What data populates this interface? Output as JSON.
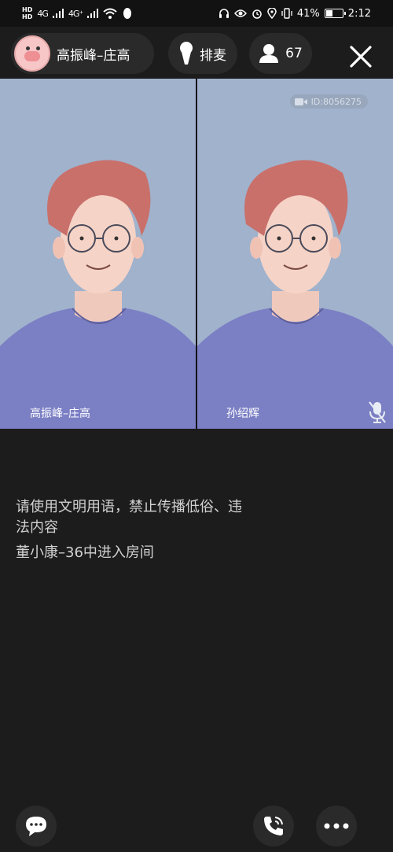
{
  "status_bar": {
    "hd_top": "HD",
    "hd_bottom": "HD",
    "network_1": "4G",
    "network_2": "4G⁺",
    "battery_percent": "41%",
    "battery_level": 0.41,
    "time": "2:12"
  },
  "header": {
    "host_name": "高振峰–庄高",
    "queue_label": "排麦",
    "viewer_count": "67"
  },
  "video": {
    "room_id": "ID:8056275",
    "left_panel_name": "高振峰–庄高",
    "right_panel_name": "孙绍辉"
  },
  "messages": [
    "请使用文明用语，禁止传播低俗、违法内容",
    "董小康–36中进入房间"
  ],
  "icons": {
    "header": [
      "mic-icon",
      "user-icon",
      "close-icon"
    ],
    "bottom": [
      "chat-bubble-icon",
      "phone-call-icon",
      "more-dots-icon"
    ],
    "video": [
      "video-camera-icon",
      "mic-muted-icon"
    ]
  },
  "colors": {
    "background": "#1c1c1c",
    "chip": "#2a2a2a",
    "video_bg": "#a0b2cc",
    "shirt": "#7b7fc4",
    "hair": "#c9706b"
  }
}
